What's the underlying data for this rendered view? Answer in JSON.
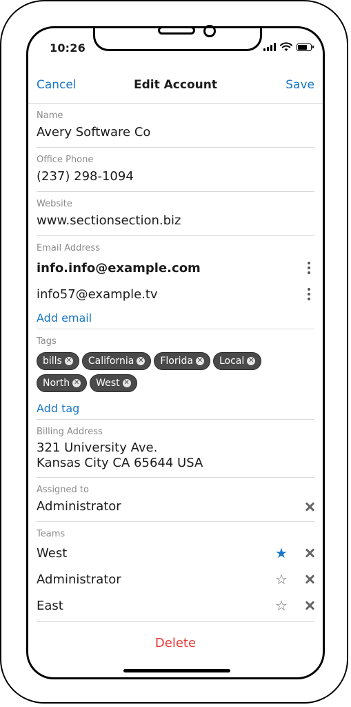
{
  "status": {
    "time": "10:26"
  },
  "nav": {
    "cancel": "Cancel",
    "title": "Edit Account",
    "save": "Save"
  },
  "fields": {
    "name": {
      "label": "Name",
      "value": "Avery Software Co"
    },
    "phone": {
      "label": "Office Phone",
      "value": "(237) 298-1094"
    },
    "website": {
      "label": "Website",
      "value": "www.sectionsection.biz"
    },
    "email": {
      "label": "Email Address",
      "items": [
        "info.info@example.com",
        "info57@example.tv"
      ],
      "add_label": "Add email"
    },
    "tags": {
      "label": "Tags",
      "items": [
        "bills",
        "California",
        "Florida",
        "Local",
        "North",
        "West"
      ],
      "add_label": "Add tag"
    },
    "billing": {
      "label": "Billing Address",
      "line1": "321 University Ave.",
      "line2": "Kansas City CA 65644 USA"
    },
    "assigned": {
      "label": "Assigned to",
      "value": "Administrator"
    },
    "teams": {
      "label": "Teams",
      "items": [
        {
          "name": "West",
          "primary": true
        },
        {
          "name": "Administrator",
          "primary": false
        },
        {
          "name": "East",
          "primary": false
        }
      ]
    }
  },
  "actions": {
    "delete": "Delete"
  },
  "colors": {
    "accent": "#1976c7",
    "danger": "#e53935",
    "tag_bg": "#4a4a4a"
  },
  "icons": [
    "signal-icon",
    "wifi-icon",
    "battery-icon",
    "more-vertical-icon",
    "tag-remove-icon",
    "star-icon",
    "remove-icon"
  ]
}
